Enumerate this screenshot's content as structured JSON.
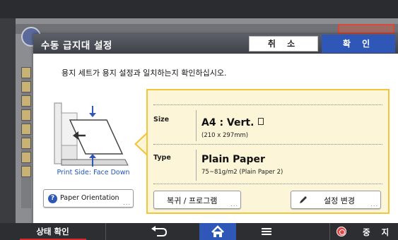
{
  "dialog": {
    "title": "수동 급지대 설정",
    "cancel_label": "취 소",
    "ok_label": "확 인",
    "message": "용지 세트가 용지 설정과 일치하는지 확인하십시오."
  },
  "illustration": {
    "print_side_label": "Print Side: Face Down",
    "orientation_button": "Paper Orientation",
    "more_indicator": "..."
  },
  "paper_info": {
    "size_label": "Size",
    "size_value": "A4 : Vert.",
    "size_detail": "(210 x 297mm)",
    "type_label": "Type",
    "type_value": "Plain Paper",
    "type_detail": "75~81g/m2 (Plain Paper 2)",
    "restore_button": "복귀 / 프로그램",
    "change_button": "설정 변경",
    "more_indicator": "..."
  },
  "bottom_bar": {
    "status_label": "상태 확인",
    "stop_label": "중 지"
  },
  "colors": {
    "accent_blue": "#2f57b8",
    "panel_border": "#f2c53a",
    "panel_bg": "#fdf5d8",
    "stop_red": "#e04848"
  },
  "icons": [
    "help-icon",
    "document-icon",
    "pencil-icon",
    "back-icon",
    "home-icon",
    "menu-icon",
    "stop-icon"
  ]
}
